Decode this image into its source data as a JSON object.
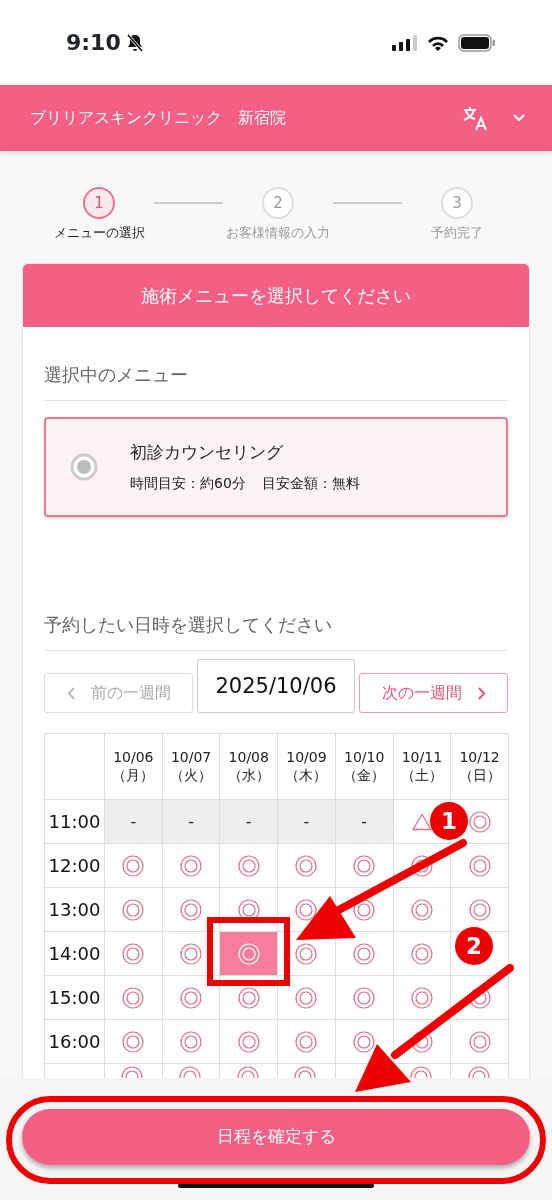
{
  "status_bar": {
    "time": "9:10",
    "muted": true
  },
  "header": {
    "title": "ブリリアスキンクリニック　新宿院"
  },
  "steps": [
    {
      "number": "1",
      "label": "メニューの選択",
      "selected": true
    },
    {
      "number": "2",
      "label": "お客様情報の入力",
      "selected": false
    },
    {
      "number": "3",
      "label": "予約完了",
      "selected": false
    }
  ],
  "card": {
    "title": "施術メニューを選択してください",
    "menu_section": {
      "heading": "選択中のメニュー",
      "option": {
        "name": "初診カウンセリング",
        "checked": true,
        "details": [
          "時間目安：約60分",
          "目安金額：無料"
        ]
      }
    },
    "date_section": {
      "heading": "予約したい日時を選択してください",
      "prev_button": {
        "label": "前の一週間",
        "disabled": true
      },
      "date_field": {
        "value": "2025/10/06"
      },
      "next_button": {
        "label": "次の一週間",
        "disabled": false
      },
      "days": [
        {
          "date": "10/06",
          "weekday": "（月）"
        },
        {
          "date": "10/07",
          "weekday": "（火）"
        },
        {
          "date": "10/08",
          "weekday": "（水）"
        },
        {
          "date": "10/09",
          "weekday": "（木）"
        },
        {
          "date": "10/10",
          "weekday": "（金）"
        },
        {
          "date": "10/11",
          "weekday": "（土）"
        },
        {
          "date": "10/12",
          "weekday": "（日）"
        }
      ],
      "rows": [
        {
          "time": "11:00",
          "slots": [
            {
              "kind": "closed",
              "text": "-",
              "selected": false
            },
            {
              "kind": "closed",
              "text": "-",
              "selected": false
            },
            {
              "kind": "closed",
              "text": "-",
              "selected": false
            },
            {
              "kind": "closed",
              "text": "-",
              "selected": false
            },
            {
              "kind": "closed",
              "text": "-",
              "selected": false
            },
            {
              "kind": "few",
              "selected": false
            },
            {
              "kind": "available",
              "selected": false
            }
          ]
        },
        {
          "time": "12:00",
          "slots": [
            {
              "kind": "available",
              "selected": false
            },
            {
              "kind": "available",
              "selected": false
            },
            {
              "kind": "available",
              "selected": false
            },
            {
              "kind": "available",
              "selected": false
            },
            {
              "kind": "available",
              "selected": false
            },
            {
              "kind": "available",
              "selected": false
            },
            {
              "kind": "available",
              "selected": false
            }
          ]
        },
        {
          "time": "13:00",
          "slots": [
            {
              "kind": "available",
              "selected": false
            },
            {
              "kind": "available",
              "selected": false
            },
            {
              "kind": "available",
              "selected": false
            },
            {
              "kind": "available",
              "selected": false
            },
            {
              "kind": "available",
              "selected": false
            },
            {
              "kind": "available",
              "selected": false
            },
            {
              "kind": "available",
              "selected": false
            }
          ]
        },
        {
          "time": "14:00",
          "slots": [
            {
              "kind": "available",
              "selected": false
            },
            {
              "kind": "available",
              "selected": false
            },
            {
              "kind": "available",
              "selected": true
            },
            {
              "kind": "available",
              "selected": false
            },
            {
              "kind": "available",
              "selected": false
            },
            {
              "kind": "available",
              "selected": false
            },
            {
              "kind": "covered"
            }
          ]
        },
        {
          "time": "15:00",
          "slots": [
            {
              "kind": "available",
              "selected": false
            },
            {
              "kind": "available",
              "selected": false
            },
            {
              "kind": "available",
              "selected": false
            },
            {
              "kind": "available",
              "selected": false
            },
            {
              "kind": "available",
              "selected": false
            },
            {
              "kind": "available",
              "selected": false
            },
            {
              "kind": "available",
              "selected": false
            }
          ]
        },
        {
          "time": "16:00",
          "slots": [
            {
              "kind": "available",
              "selected": false
            },
            {
              "kind": "available",
              "selected": false
            },
            {
              "kind": "available",
              "selected": false
            },
            {
              "kind": "available",
              "selected": false
            },
            {
              "kind": "available",
              "selected": false
            },
            {
              "kind": "available",
              "selected": false
            },
            {
              "kind": "available",
              "selected": false
            }
          ]
        },
        {
          "slots": [
            {
              "kind": "available",
              "selected": false
            },
            {
              "kind": "available",
              "selected": false
            },
            {
              "kind": "available",
              "selected": false
            },
            {
              "kind": "available",
              "selected": false
            },
            {
              "kind": "covered"
            },
            {
              "kind": "available",
              "selected": false
            },
            {
              "kind": "available",
              "selected": false
            }
          ]
        }
      ]
    }
  },
  "confirm_button": {
    "label": "日程を確定する"
  },
  "annotations": [
    {
      "number": "1"
    },
    {
      "number": "2"
    }
  ]
}
